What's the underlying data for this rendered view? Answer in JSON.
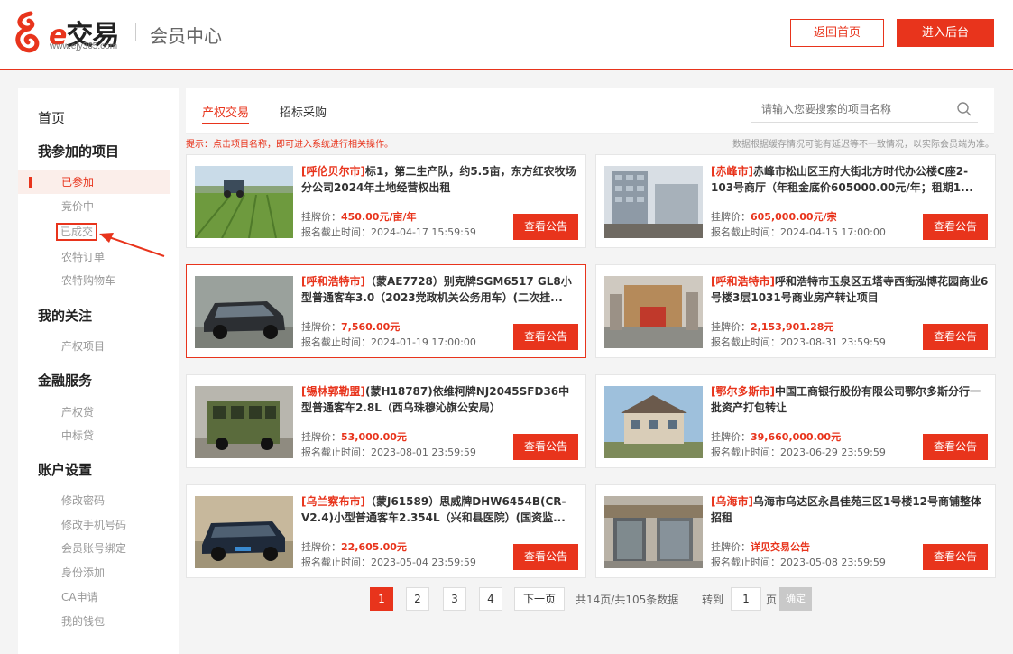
{
  "header": {
    "logo_text_e": "e",
    "logo_text_rest": "交易",
    "logo_url": "www.ejy365.com",
    "site_title": "会员中心",
    "btn_home": "返回首页",
    "btn_admin": "进入后台",
    "accent": "#e8341c"
  },
  "sidebar": {
    "home": "首页",
    "groups": [
      {
        "title": "我参加的项目",
        "items": [
          "已参加",
          "竞价中",
          "已成交",
          "农特订单",
          "农特购物车"
        ]
      },
      {
        "title": "我的关注",
        "items": [
          "产权项目"
        ]
      },
      {
        "title": "金融服务",
        "items": [
          "产权贷",
          "中标贷"
        ]
      },
      {
        "title": "账户设置",
        "items": [
          "修改密码",
          "修改手机号码",
          "会员账号绑定",
          "身份添加",
          "CA申请",
          "我的钱包"
        ]
      }
    ]
  },
  "tabs": [
    "产权交易",
    "招标采购"
  ],
  "search": {
    "placeholder": "请输入您要搜索的项目名称"
  },
  "hints": {
    "left": "提示：点击项目名称，即可进入系统进行相关操作。",
    "right": "数据根据缓存情况可能有延迟等不一致情况，以实际会员端为准。"
  },
  "card_labels": {
    "price": "挂牌价：",
    "deadline": "报名截止时间：",
    "button": "查看公告"
  },
  "cards": [
    {
      "city": "[呼伦贝尔市]",
      "title": "标1，第二生产队，约5.5亩，东方红农牧场分公司2024年土地经营权出租",
      "price": "450.00元/亩/年",
      "deadline": "2024-04-17 15:59:59",
      "img": "farm-field"
    },
    {
      "city": "[赤峰市]",
      "title": "赤峰市松山区王府大街北方时代办公楼C座2-103号商厅（年租金底价605000.00元/年；租期1...",
      "price": "605,000.00元/宗",
      "deadline": "2024-04-15 17:00:00",
      "img": "office-building"
    },
    {
      "city": "[呼和浩特市]",
      "title": "（蒙AE7728）别克牌SGM6517 GL8小型普通客车3.0（2023党政机关公务用车）(二次挂...",
      "price": "7,560.00元",
      "deadline": "2024-01-19 17:00:00",
      "img": "gray-car"
    },
    {
      "city": "[呼和浩特市]",
      "title": "呼和浩特市玉泉区五塔寺西街泓博花园商业6号楼3层1031号商业房产转让项目",
      "price": "2,153,901.28元",
      "deadline": "2023-08-31 23:59:59",
      "img": "commercial-street"
    },
    {
      "city": "[锡林郭勒盟]",
      "title": "(蒙H18787)依维柯牌NJ2045SFD36中型普通客车2.8L（西乌珠穆沁旗公安局）",
      "price": "53,000.00元",
      "deadline": "2023-08-01 23:59:59",
      "img": "green-van"
    },
    {
      "city": "[鄂尔多斯市]",
      "title": "中国工商银行股份有限公司鄂尔多斯分行一批资产打包转让",
      "price": "39,660,000.00元",
      "deadline": "2023-06-29 23:59:59",
      "img": "house"
    },
    {
      "city": "[乌兰察布市]",
      "title": "（蒙J61589）思威牌DHW6454B(CR-V2.4)小型普通客车2.354L（兴和县医院）(国资监...",
      "price": "22,605.00元",
      "deadline": "2023-05-04 23:59:59",
      "img": "black-suv"
    },
    {
      "city": "[乌海市]",
      "title": "乌海市乌达区永昌佳苑三区1号楼12号商铺整体招租",
      "price": "详见交易公告",
      "deadline": "2023-05-08 23:59:59",
      "img": "shopfront"
    }
  ],
  "pager": {
    "pages": [
      "1",
      "2",
      "3",
      "4"
    ],
    "next": "下一页",
    "total": "共14页/共105条数据",
    "goto": "转到",
    "goto_value": "1",
    "unit": "页",
    "ok": "确定"
  }
}
